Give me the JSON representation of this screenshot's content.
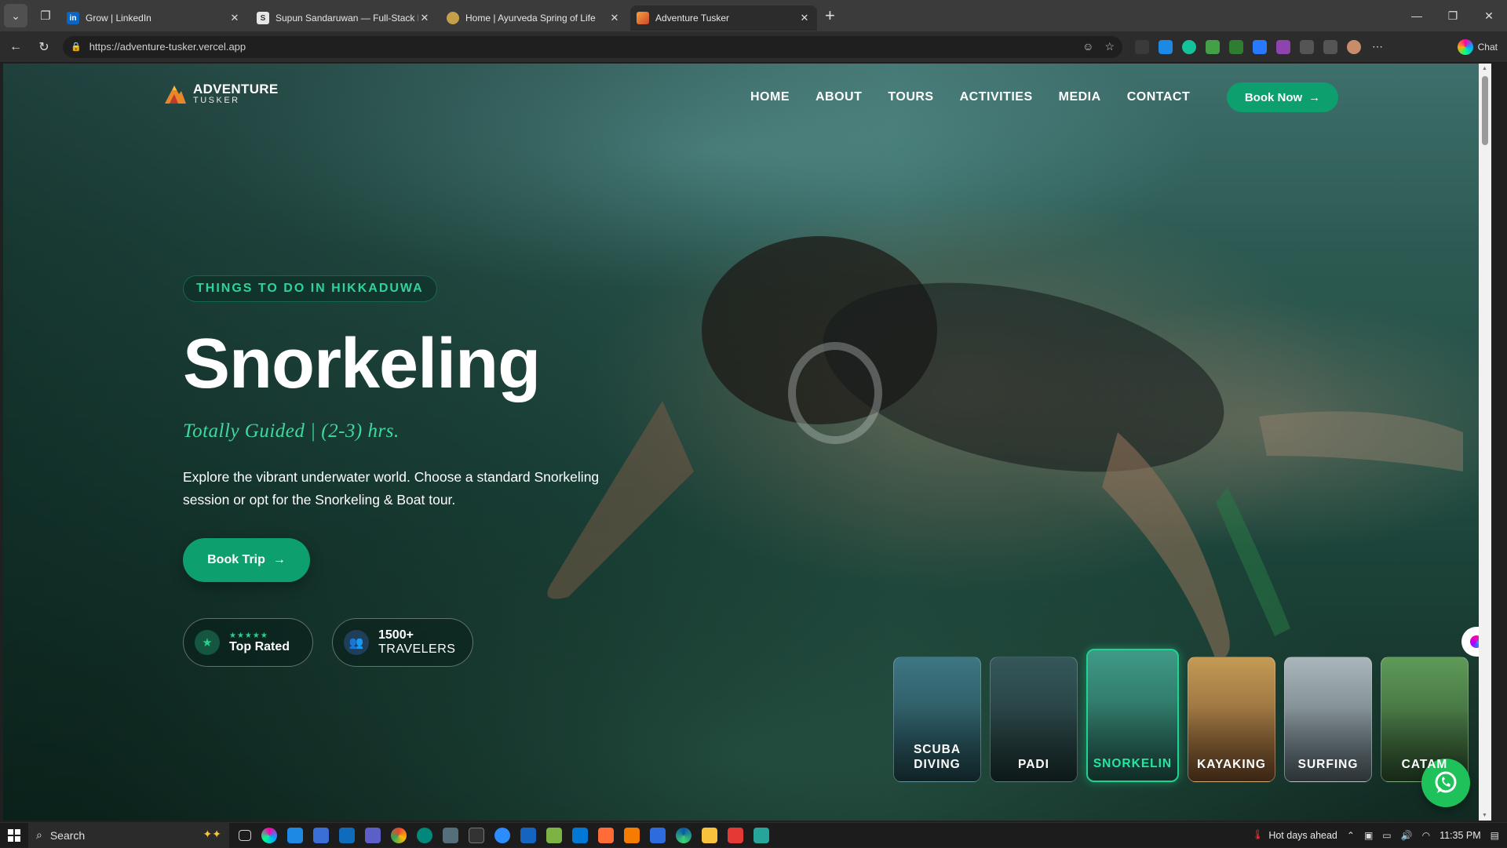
{
  "browser": {
    "tabs": [
      {
        "title": "Grow | LinkedIn",
        "favicon": "in",
        "color": "#0a66c2"
      },
      {
        "title": "Supun Sandaruwan — Full-Stack D",
        "favicon": "S",
        "color": "#e6e6e6"
      },
      {
        "title": "Home | Ayurveda Spring of Life",
        "favicon": "",
        "color": "#c4a04a"
      },
      {
        "title": "Adventure Tusker",
        "favicon": "",
        "color": "#e07b2a"
      }
    ],
    "url": "https://adventure-tusker.vercel.app",
    "chat_label": "Chat"
  },
  "site": {
    "logo": {
      "line1": "ADVENTURE",
      "line2": "TUSKER"
    },
    "nav": [
      "HOME",
      "ABOUT",
      "TOURS",
      "ACTIVITIES",
      "MEDIA",
      "CONTACT"
    ],
    "book_now": "Book Now",
    "hero": {
      "eyebrow": "THINGS TO DO IN HIKKADUWA",
      "title": "Snorkeling",
      "subtitle": "Totally Guided | (2-3) hrs.",
      "description": "Explore the vibrant underwater world. Choose a standard Snorkeling session or opt for the Snorkeling & Boat tour.",
      "cta": "Book Trip"
    },
    "badges": {
      "rated": {
        "stars": "★★★★★",
        "label": "Top Rated"
      },
      "travelers": {
        "count": "1500+",
        "label": "TRAVELERS"
      }
    },
    "activities": [
      {
        "line1": "SCUBA",
        "line2": "DIVING",
        "bg": "#2f5f6a"
      },
      {
        "line1": "PADI",
        "line2": "",
        "bg": "#2a4846"
      },
      {
        "line1": "SNORKELIN",
        "line2": "",
        "bg": "#2f7d6e"
      },
      {
        "line1": "KAYAKING",
        "line2": "",
        "bg": "#8a6a3d"
      },
      {
        "line1": "SURFING",
        "line2": "",
        "bg": "#7e8c93"
      },
      {
        "line1": "CATAM",
        "line2": "",
        "bg": "#3f6e3b"
      }
    ]
  },
  "taskbar": {
    "search": "Search",
    "weather": "Hot days ahead",
    "time": "11:35 PM"
  }
}
